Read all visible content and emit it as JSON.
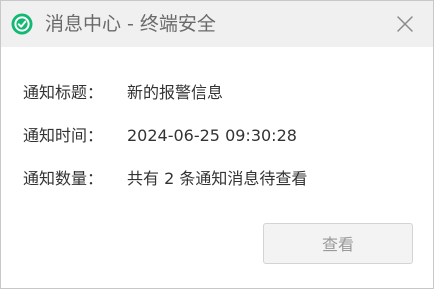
{
  "window": {
    "title": "消息中心 - 终端安全",
    "icon": "shield-check-icon",
    "close_icon": "close-icon"
  },
  "fields": [
    {
      "label": "通知标题：",
      "value": "新的报警信息"
    },
    {
      "label": "通知时间：",
      "value": "2024-06-25 09:30:28"
    },
    {
      "label": "通知数量：",
      "value": "共有 2 条通知消息待查看"
    }
  ],
  "actions": {
    "view_label": "查看"
  },
  "colors": {
    "icon_green": "#13b873",
    "titlebar_bg": "#f0f0f0",
    "button_bg": "#f3f3f3"
  }
}
